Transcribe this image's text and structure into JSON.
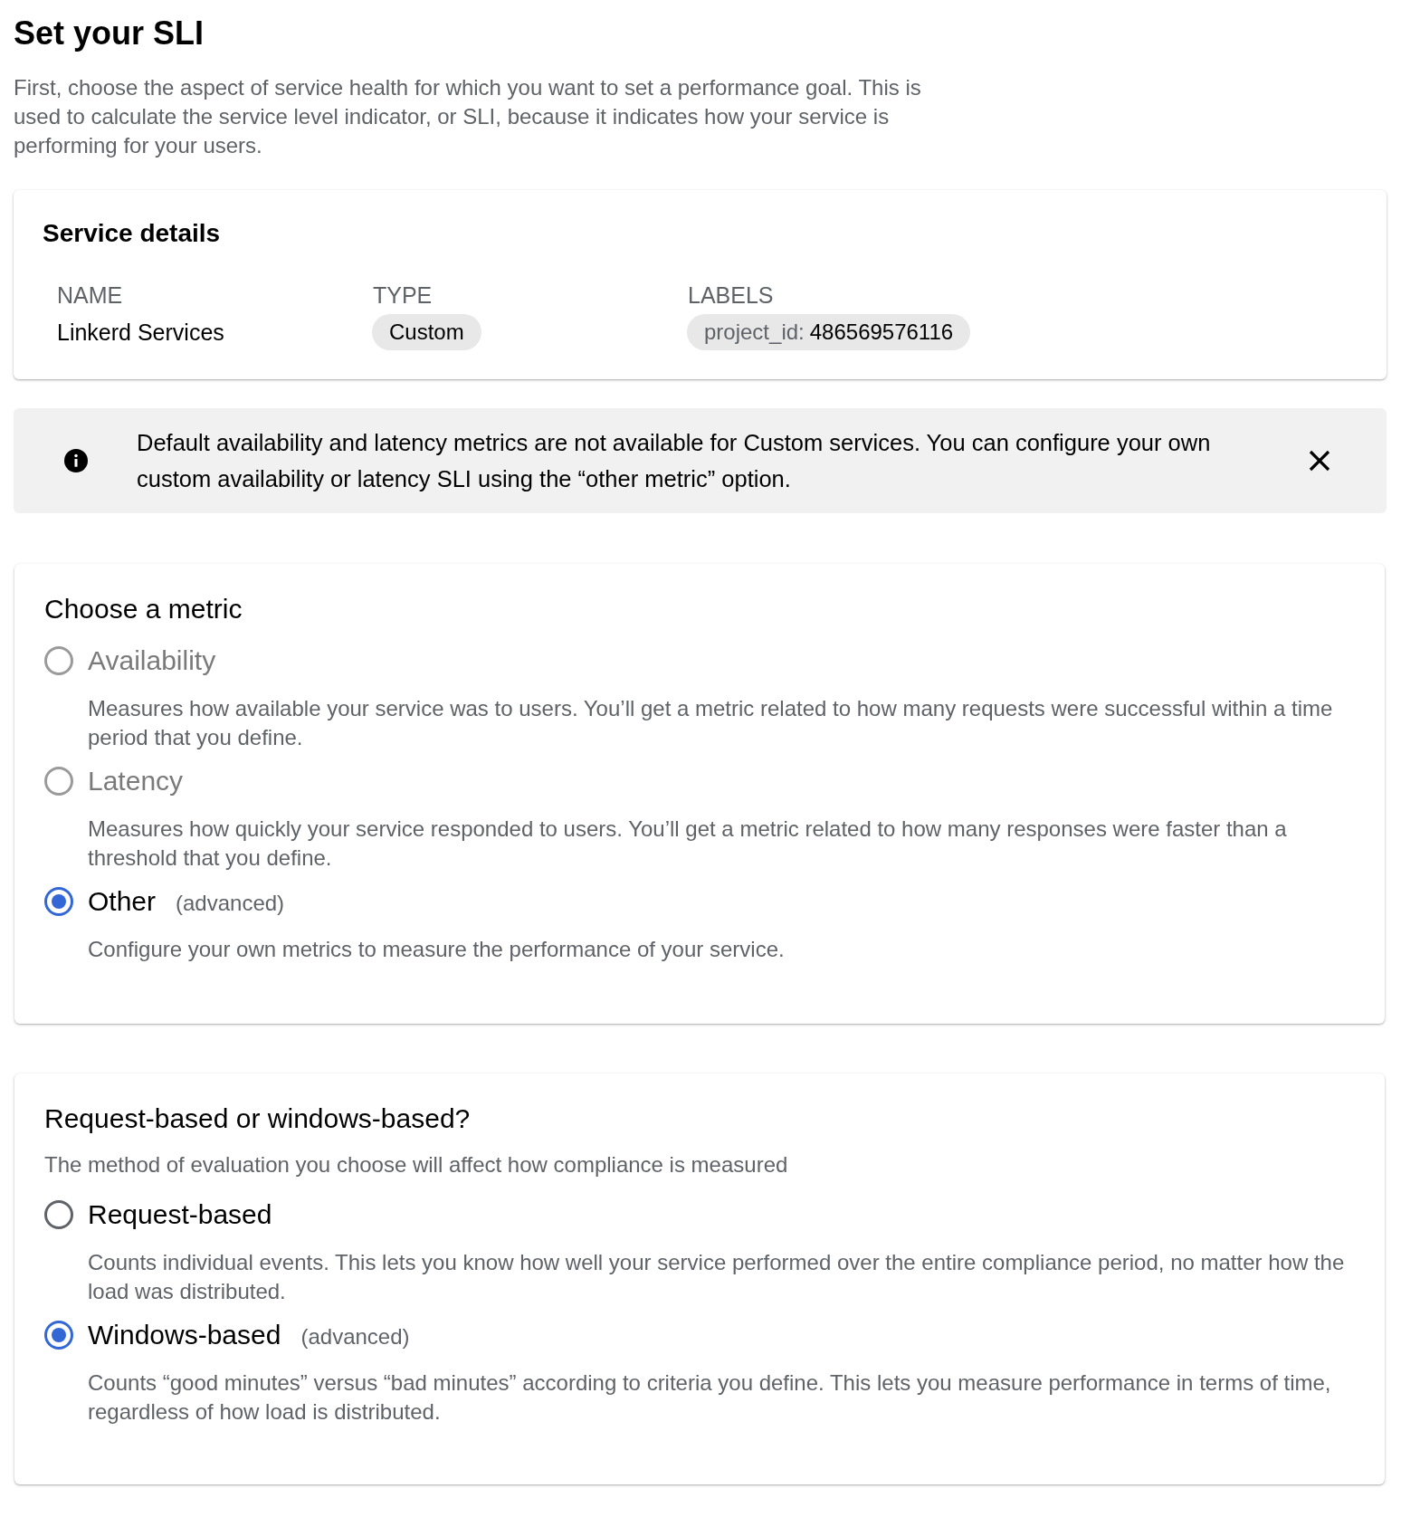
{
  "page": {
    "title": "Set your SLI",
    "intro": "First, choose the aspect of service health for which you want to set a performance goal. This is used to calculate the service level indicator, or SLI, because it indicates how your service is performing for your users."
  },
  "service_details": {
    "title": "Service details",
    "fields": [
      {
        "kind": "text",
        "label": "NAME",
        "value": "Linkerd Services"
      },
      {
        "kind": "chip",
        "label": "TYPE",
        "value": "Custom"
      },
      {
        "kind": "label_chip",
        "label": "LABELS",
        "key": "project_id:",
        "value": "486569576116"
      }
    ]
  },
  "info_banner": {
    "message": "Default availability and latency metrics are not available for Custom services. You can configure your own custom availability or latency SLI using the “other metric” option."
  },
  "metric_card": {
    "title": "Choose a metric",
    "options": [
      {
        "label": "Availability",
        "description": "Measures how available your service was to users. You’ll get a metric related to how many requests were successful within a time period that you define.",
        "selected": false,
        "disabled": true
      },
      {
        "label": "Latency",
        "description": "Measures how quickly your service responded to users. You’ll get a metric related to how many responses were faster than a threshold that you define.",
        "selected": false,
        "disabled": true
      },
      {
        "label": "Other",
        "tag": "(advanced)",
        "description": "Configure your own metrics to measure the performance of your service.",
        "selected": true,
        "disabled": false
      }
    ]
  },
  "evaluation_card": {
    "title": "Request-based or windows-based?",
    "subtitle": "The method of evaluation you choose will affect how compliance is measured",
    "options": [
      {
        "label": "Request-based",
        "description": "Counts individual events. This lets you know how well your service performed over the entire compliance period, no matter how the load was distributed.",
        "selected": false,
        "disabled": false
      },
      {
        "label": "Windows-based",
        "tag": "(advanced)",
        "description": "Counts “good minutes” versus “bad minutes” according to criteria you define. This lets you measure performance in terms of time, regardless of how load is distributed.",
        "selected": true,
        "disabled": false
      }
    ]
  }
}
